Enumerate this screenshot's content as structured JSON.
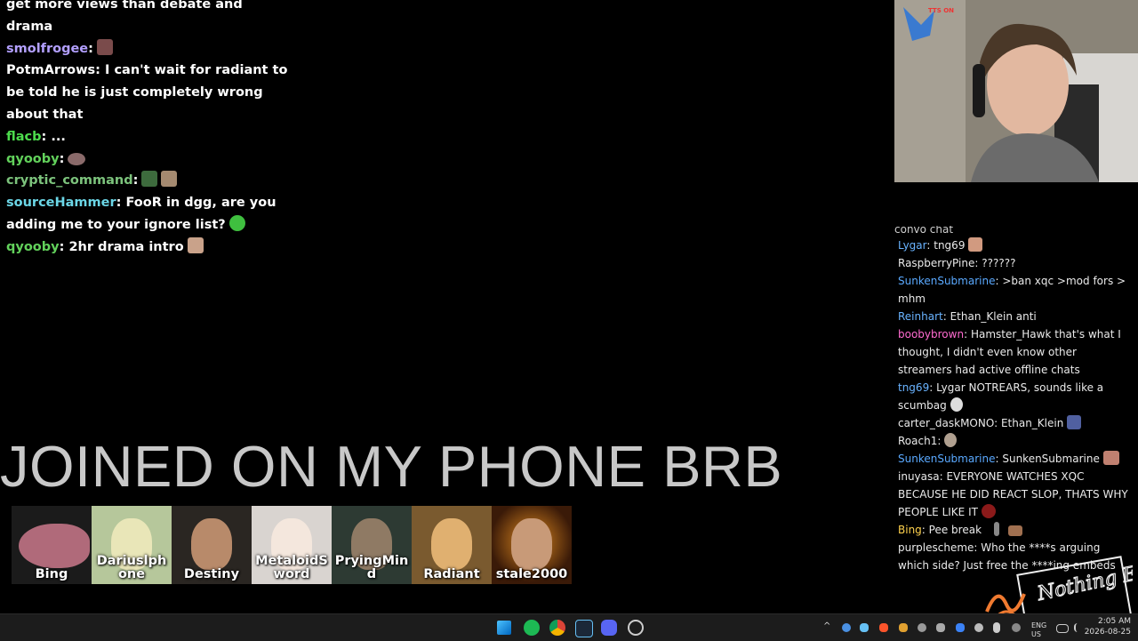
{
  "left_chat": [
    {
      "user": "",
      "text": "get more views than debate and drama",
      "color": "#ffffff"
    },
    {
      "user": "smolfrogee",
      "text": "",
      "color": "#b3a0ff",
      "emote": "frog-emote"
    },
    {
      "user": "PotmArrows",
      "text": "I can't wait for radiant to be told he is just completely wrong about that",
      "color": "#ffffff"
    },
    {
      "user": "flacb",
      "text": "...",
      "color": "#4ddc4d"
    },
    {
      "user": "qyooby",
      "text": "",
      "color": "#62d15b",
      "emote": "pointing-emote"
    },
    {
      "user": "cryptic_command",
      "text": "",
      "color": "#7cc37c",
      "emote": "pepe-emote"
    },
    {
      "user": "sourceHammer",
      "text": "FooR in dgg, are you adding me to your ignore list?",
      "color": "#6bd6e6",
      "emote": "green-emote"
    },
    {
      "user": "qyooby",
      "text": "2hr drama intro",
      "color": "#62d15b",
      "emote": "face-emote"
    }
  ],
  "banner": "JOINED ON MY PHONE BRB",
  "tiles": [
    {
      "name": "Bing",
      "bg": "#1b1b1b",
      "face": "#b06a7a"
    },
    {
      "name": "Dariuslph one",
      "bg": "#b6c79b",
      "face": "#e9e6b8"
    },
    {
      "name": "Destiny",
      "bg": "#2a2622",
      "face": "#b88a6a"
    },
    {
      "name": "MetaloidS word",
      "bg": "#d9d4d0",
      "face": "#f4e7dd"
    },
    {
      "name": "PryingMin d",
      "bg": "#2d3a33",
      "face": "#8f7a64"
    },
    {
      "name": "Radiant",
      "bg": "#7a5a2f",
      "face": "#e0b070"
    },
    {
      "name": "stale2000",
      "bg": "#3a1a08",
      "face": "#c89a78"
    }
  ],
  "right_chat": [
    {
      "user": "",
      "text": "convo chat",
      "color": "#cfcfcf"
    },
    {
      "user": "Lygar",
      "text": "tng69",
      "color": "#69b3ff",
      "emote": true
    },
    {
      "user": "RaspberryPine",
      "text": "??????",
      "color": "#eaeaea"
    },
    {
      "user": "SunkenSubmarine",
      "text": ">ban xqc >mod fors > mhm",
      "color": "#5aa9ff"
    },
    {
      "user": "Reinhart",
      "text": "Ethan_Klein anti",
      "color": "#69b3ff"
    },
    {
      "user": "boobybrown",
      "text": "Hamster_Hawk that's what I thought, I didn't even know other streamers had active offline chats",
      "color": "#ff6bd0"
    },
    {
      "user": "tng69",
      "text": "Lygar NOTREARS, sounds like a scumbag",
      "color": "#69b3ff",
      "emote": true
    },
    {
      "user": "carter_daskMONO",
      "text": "Ethan_Klein",
      "color": "#eaeaea",
      "emote": true
    },
    {
      "user": "Roach1",
      "text": "",
      "color": "#eaeaea",
      "emote": true
    },
    {
      "user": "SunkenSubmarine",
      "text": "SunkenSubmarine",
      "color": "#5aa9ff",
      "emote": true
    },
    {
      "user": "inuyasa",
      "text": "EVERYONE WATCHES XQC BECAUSE HE DID REACT SLOP, THATS WHY PEOPLE LIKE IT",
      "color": "#eaeaea",
      "emote": true
    },
    {
      "user": "Bing",
      "text": "Pee break",
      "color": "#ffd24d",
      "emote": true
    },
    {
      "user": "purplescheme",
      "text": "Who the ****s arguing which side? Just free the ****ing embeds",
      "color": "#eaeaea"
    }
  ],
  "taskbar": {
    "tray_lang": "ENG US",
    "time": "2:05 AM",
    "date": "2026-08-25"
  },
  "logo_text": "Nothing Else?",
  "webcam_logo": "TTS ON",
  "colors": {
    "background": "#000000",
    "banner": "#c8c8c8",
    "taskbar": "#1c1c1c"
  }
}
